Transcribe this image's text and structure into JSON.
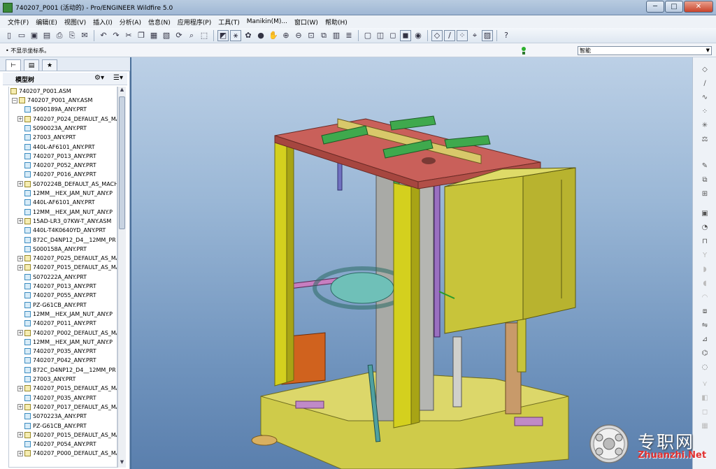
{
  "window": {
    "title": "740207_P001 (活动的) - Pro/ENGINEER Wildfire 5.0",
    "minimize": "─",
    "maximize": "□",
    "close": "✕"
  },
  "menu": [
    "文件(F)",
    "编辑(E)",
    "视图(V)",
    "插入(I)",
    "分析(A)",
    "信息(N)",
    "应用程序(P)",
    "工具(T)",
    "Manikin(M)...",
    "窗口(W)",
    "帮助(H)"
  ],
  "status": {
    "message": "• 不显示坐标系。",
    "filter": "智能"
  },
  "tree": {
    "header": "模型树",
    "root": "740207_P001.ASM",
    "items": [
      {
        "label": "740207_P001_ANY.ASM",
        "type": "asm",
        "expand": "−",
        "level": 1
      },
      {
        "label": "S090189A_ANY.PRT",
        "type": "part",
        "expand": "",
        "level": 2
      },
      {
        "label": "740207_P024_DEFAULT_AS_MA",
        "type": "asm",
        "expand": "+",
        "level": 2
      },
      {
        "label": "S090023A_ANY.PRT",
        "type": "part",
        "expand": "",
        "level": 2
      },
      {
        "label": "27003_ANY.PRT",
        "type": "part",
        "expand": "",
        "level": 2
      },
      {
        "label": "440L-AF6101_ANY.PRT",
        "type": "part",
        "expand": "",
        "level": 2
      },
      {
        "label": "740207_P013_ANY.PRT",
        "type": "part",
        "expand": "",
        "level": 2
      },
      {
        "label": "740207_P052_ANY.PRT",
        "type": "part",
        "expand": "",
        "level": 2
      },
      {
        "label": "740207_P016_ANY.PRT",
        "type": "part",
        "expand": "",
        "level": 2
      },
      {
        "label": "S070224B_DEFAULT_AS_MACH",
        "type": "asm",
        "expand": "+",
        "level": 2
      },
      {
        "label": "12MM__HEX_JAM_NUT_ANY.P",
        "type": "part",
        "expand": "",
        "level": 2
      },
      {
        "label": "440L-AF6101_ANY.PRT",
        "type": "part",
        "expand": "",
        "level": 2
      },
      {
        "label": "12MM__HEX_JAM_NUT_ANY.P",
        "type": "part",
        "expand": "",
        "level": 2
      },
      {
        "label": "15AD-LR3_07KW-T_ANY.ASM",
        "type": "asm",
        "expand": "+",
        "level": 2
      },
      {
        "label": "440L-T4K0640YD_ANY.PRT",
        "type": "part",
        "expand": "",
        "level": 2
      },
      {
        "label": "872C_D4NP12_D4__12MM_PR",
        "type": "part",
        "expand": "",
        "level": 2
      },
      {
        "label": "S000158A_ANY.PRT",
        "type": "part",
        "expand": "",
        "level": 2
      },
      {
        "label": "740207_P025_DEFAULT_AS_MA",
        "type": "asm",
        "expand": "+",
        "level": 2
      },
      {
        "label": "740207_P015_DEFAULT_AS_MA",
        "type": "asm",
        "expand": "+",
        "level": 2
      },
      {
        "label": "S070222A_ANY.PRT",
        "type": "part",
        "expand": "",
        "level": 2
      },
      {
        "label": "740207_P013_ANY.PRT",
        "type": "part",
        "expand": "",
        "level": 2
      },
      {
        "label": "740207_P055_ANY.PRT",
        "type": "part",
        "expand": "",
        "level": 2
      },
      {
        "label": "PZ-G61CB_ANY.PRT",
        "type": "part",
        "expand": "",
        "level": 2
      },
      {
        "label": "12MM__HEX_JAM_NUT_ANY.P",
        "type": "part",
        "expand": "",
        "level": 2
      },
      {
        "label": "740207_P011_ANY.PRT",
        "type": "part",
        "expand": "",
        "level": 2
      },
      {
        "label": "740207_P002_DEFAULT_AS_MA",
        "type": "asm",
        "expand": "+",
        "level": 2
      },
      {
        "label": "12MM__HEX_JAM_NUT_ANY.P",
        "type": "part",
        "expand": "",
        "level": 2
      },
      {
        "label": "740207_P035_ANY.PRT",
        "type": "part",
        "expand": "",
        "level": 2
      },
      {
        "label": "740207_P042_ANY.PRT",
        "type": "part",
        "expand": "",
        "level": 2
      },
      {
        "label": "872C_D4NP12_D4__12MM_PR",
        "type": "part",
        "expand": "",
        "level": 2
      },
      {
        "label": "27003_ANY.PRT",
        "type": "part",
        "expand": "",
        "level": 2
      },
      {
        "label": "740207_P015_DEFAULT_AS_MA",
        "type": "asm",
        "expand": "+",
        "level": 2
      },
      {
        "label": "740207_P035_ANY.PRT",
        "type": "part",
        "expand": "",
        "level": 2
      },
      {
        "label": "740207_P017_DEFAULT_AS_MA",
        "type": "asm",
        "expand": "+",
        "level": 2
      },
      {
        "label": "S070223A_ANY.PRT",
        "type": "part",
        "expand": "",
        "level": 2
      },
      {
        "label": "PZ-G61CB_ANY.PRT",
        "type": "part",
        "expand": "",
        "level": 2
      },
      {
        "label": "740207_P015_DEFAULT_AS_MA",
        "type": "asm",
        "expand": "+",
        "level": 2
      },
      {
        "label": "740207_P054_ANY.PRT",
        "type": "part",
        "expand": "",
        "level": 2
      },
      {
        "label": "740207_P000_DEFAULT_AS_MA",
        "type": "asm",
        "expand": "+",
        "level": 2
      }
    ]
  },
  "watermark": {
    "title": "专职网",
    "url": "Zhuanzhi.Net"
  },
  "colors": {
    "frame": "#d4d01e",
    "top_plate": "#c9605a",
    "enclosure": "#c8c43a",
    "green_bars": "#3fa94d",
    "teal_disc": "#6fc0b8",
    "orange_block": "#d0621e",
    "gray_column": "#a9aaa6",
    "viewport_bg": "#9ab7d6"
  }
}
